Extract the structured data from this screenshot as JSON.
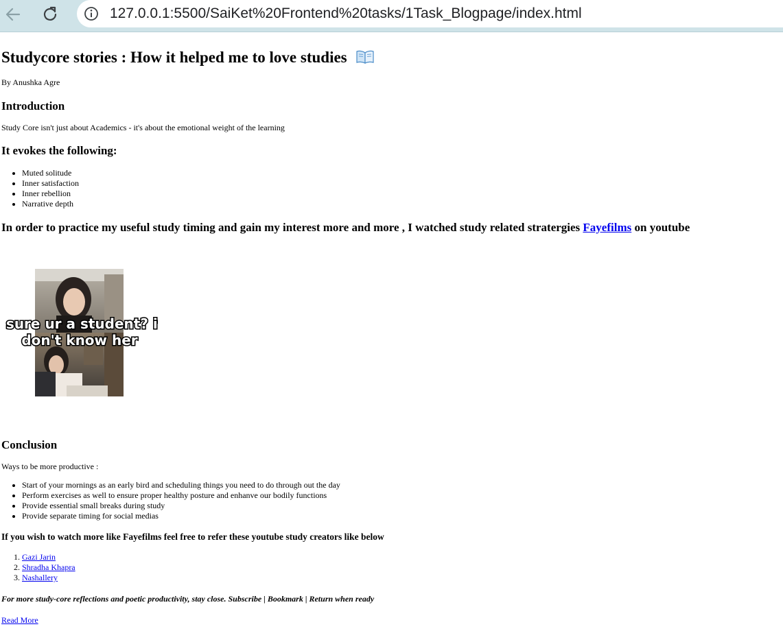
{
  "browser": {
    "url": "127.0.0.1:5500/SaiKet%20Frontend%20tasks/1Task_Blogpage/index.html"
  },
  "article": {
    "title": "Studycore stories : How it helped me to love studies",
    "title_emoji": "open-book-icon",
    "byline": "By Anushka Agre",
    "intro_heading": "Introduction",
    "intro_text": "Study Core isn't just about Academics - it's about the emotional weight of the learning",
    "evokes_heading": "It evokes the following:",
    "evokes_items": [
      "Muted solitude",
      "Inner satisfaction",
      "Inner rebellion",
      "Narrative depth"
    ],
    "practice_heading_pre": "In order to practice my useful study timing and gain my interest more and more , I watched study related stratergies ",
    "practice_link": "Fayefilms",
    "practice_heading_post": " on youtube",
    "photo_caption": "Ru sure ur a student? if u don't know her",
    "conclusion_heading": "Conclusion",
    "ways_text": "Ways to be more productive :",
    "productive_items": [
      "Start of your mornings as an early bird and scheduling things you need to do through out the day",
      "Perform exercises as well to ensure proper healthy posture and enhanve our bodily functions",
      "Provide essential small breaks during study",
      "Provide separate timing for social medias"
    ],
    "creators_heading": "If you wish to watch more like Fayefilms feel free to refer these youtube study creators like below",
    "creators": [
      "Gazi Jarin",
      "Shradha Khapra",
      "Nashallery"
    ],
    "closing_text": "For more study-core reflections and poetic productivity, stay close. Subscribe | Bookmark | Return when ready",
    "read_more": "Read More"
  }
}
